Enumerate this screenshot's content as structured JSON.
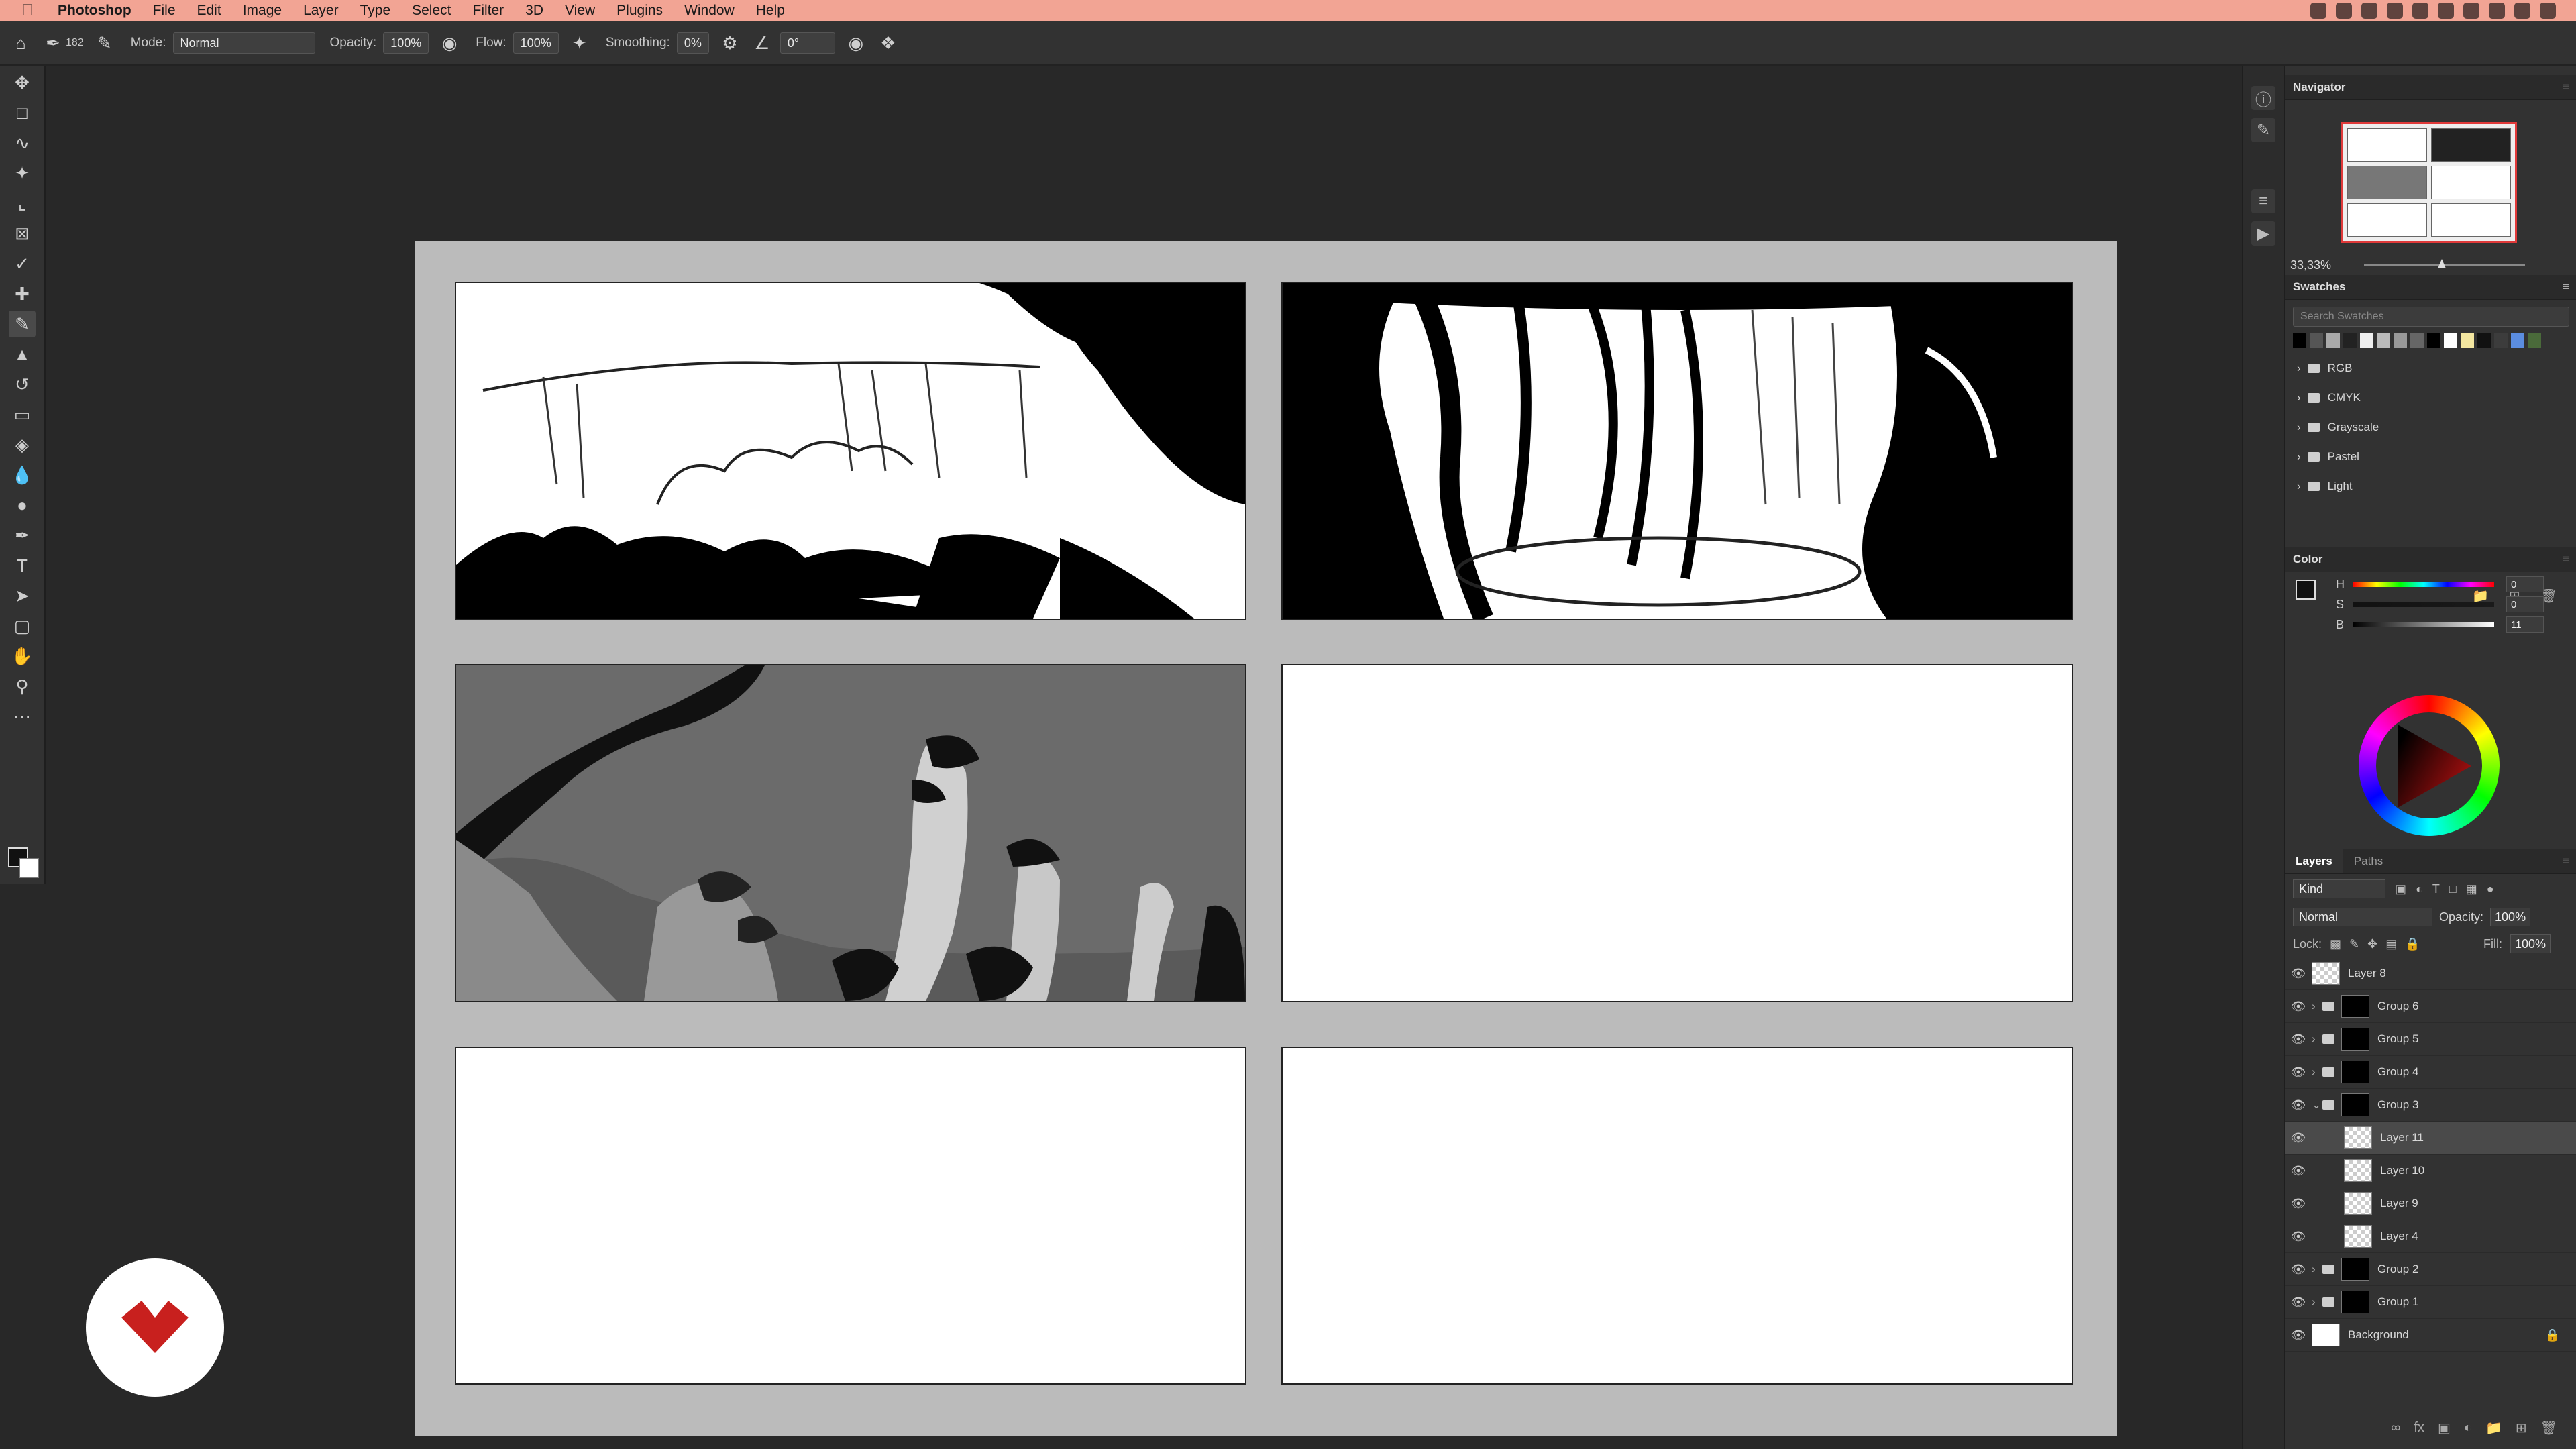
{
  "menubar": {
    "app_name": "Photoshop",
    "items": [
      "File",
      "Edit",
      "Image",
      "Layer",
      "Type",
      "Select",
      "Filter",
      "3D",
      "View",
      "Plugins",
      "Window",
      "Help"
    ]
  },
  "options": {
    "brush_size": "182",
    "mode_label": "Mode:",
    "mode_value": "Normal",
    "opacity_label": "Opacity:",
    "opacity_value": "100%",
    "flow_label": "Flow:",
    "flow_value": "100%",
    "smoothing_label": "Smoothing:",
    "smoothing_value": "0%",
    "angle_value": "0°"
  },
  "tools": [
    "move-tool",
    "marquee-tool",
    "lasso-tool",
    "magic-wand-tool",
    "crop-tool",
    "frame-tool",
    "eyedropper-tool",
    "healing-tool",
    "brush-tool",
    "stamp-tool",
    "history-brush-tool",
    "eraser-tool",
    "paint-bucket-tool",
    "blur-tool",
    "dodge-tool",
    "pen-tool",
    "type-tool",
    "path-selection-tool",
    "rectangle-tool",
    "hand-tool",
    "zoom-tool",
    "more-tools"
  ],
  "navigator": {
    "title": "Navigator",
    "zoom": "33,33%"
  },
  "swatches": {
    "title": "Swatches",
    "search_placeholder": "Search Swatches",
    "folders": [
      "RGB",
      "CMYK",
      "Grayscale",
      "Pastel",
      "Light"
    ]
  },
  "color": {
    "title": "Color",
    "h_label": "H",
    "h_value": "0",
    "s_label": "S",
    "s_value": "0",
    "b_label": "B",
    "b_value": "11"
  },
  "layers_panel": {
    "tab_layers": "Layers",
    "tab_paths": "Paths",
    "filter_kind": "Kind",
    "blend_mode": "Normal",
    "opacity_label": "Opacity:",
    "opacity_value": "100%",
    "lock_label": "Lock:",
    "fill_label": "Fill:",
    "fill_value": "100%",
    "layers": [
      {
        "name": "Layer 8",
        "kind": "layer",
        "selected": false
      },
      {
        "name": "Group 6",
        "kind": "group",
        "selected": false
      },
      {
        "name": "Group 5",
        "kind": "group",
        "selected": false
      },
      {
        "name": "Group 4",
        "kind": "group",
        "selected": false
      },
      {
        "name": "Group 3",
        "kind": "group-open",
        "selected": false
      },
      {
        "name": "Layer 11",
        "kind": "child",
        "selected": true
      },
      {
        "name": "Layer 10",
        "kind": "child",
        "selected": false
      },
      {
        "name": "Layer 9",
        "kind": "child",
        "selected": false
      },
      {
        "name": "Layer 4",
        "kind": "child",
        "selected": false
      },
      {
        "name": "Group 2",
        "kind": "group",
        "selected": false
      },
      {
        "name": "Group 1",
        "kind": "group",
        "selected": false
      },
      {
        "name": "Background",
        "kind": "background",
        "selected": false
      }
    ]
  },
  "colors": {
    "menubar_bg": "#f2a494",
    "accent_red": "#e03a3a",
    "logo_red": "#c8201e"
  }
}
